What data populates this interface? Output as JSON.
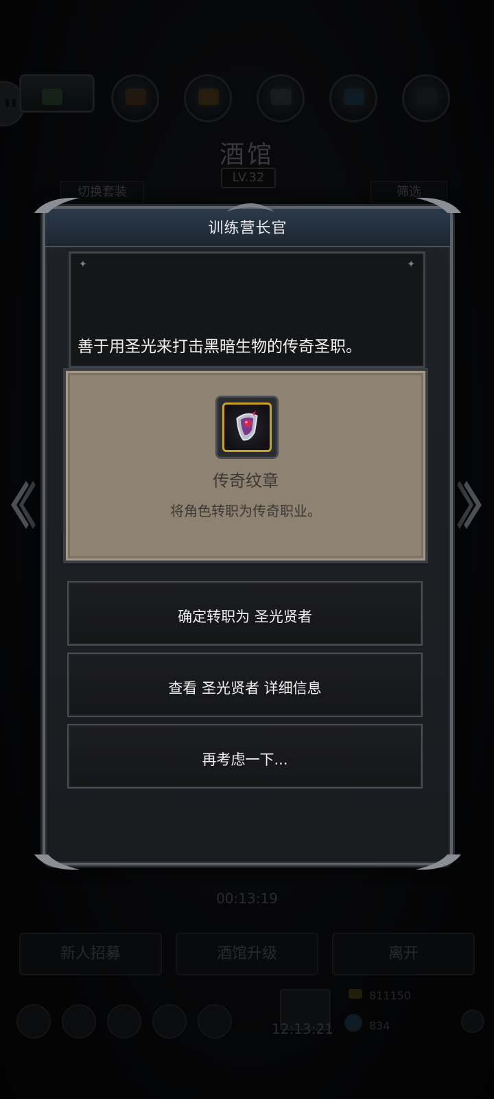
{
  "background": {
    "title": "酒馆",
    "level": "LV.32",
    "switch_outfit_label": "切换套装",
    "filter_label": "筛选",
    "timer": "00:13:19",
    "bottom_buttons": [
      "新人招募",
      "酒馆升级",
      "离开"
    ],
    "chest_timer": "12:13:21",
    "gold_amount": "811150",
    "gem_amount": "834"
  },
  "dialog": {
    "title": "训练营长官",
    "description": "善于用圣光来打击黑暗生物的传奇圣职。",
    "item": {
      "icon": "legendary-emblem-icon",
      "name": "传奇纹章",
      "effect": "将角色转职为传奇职业。"
    },
    "options": [
      "确定转职为 圣光贤者",
      "查看 圣光贤者 详细信息",
      "再考虑一下..."
    ]
  },
  "colors": {
    "dialog_bg": "#1c1e22",
    "title_bar": "#253241",
    "card_bg": "#8e8273",
    "icon_frame": "#c9a227",
    "text_light": "#f0f0f0",
    "text_dark": "#3c3833"
  }
}
